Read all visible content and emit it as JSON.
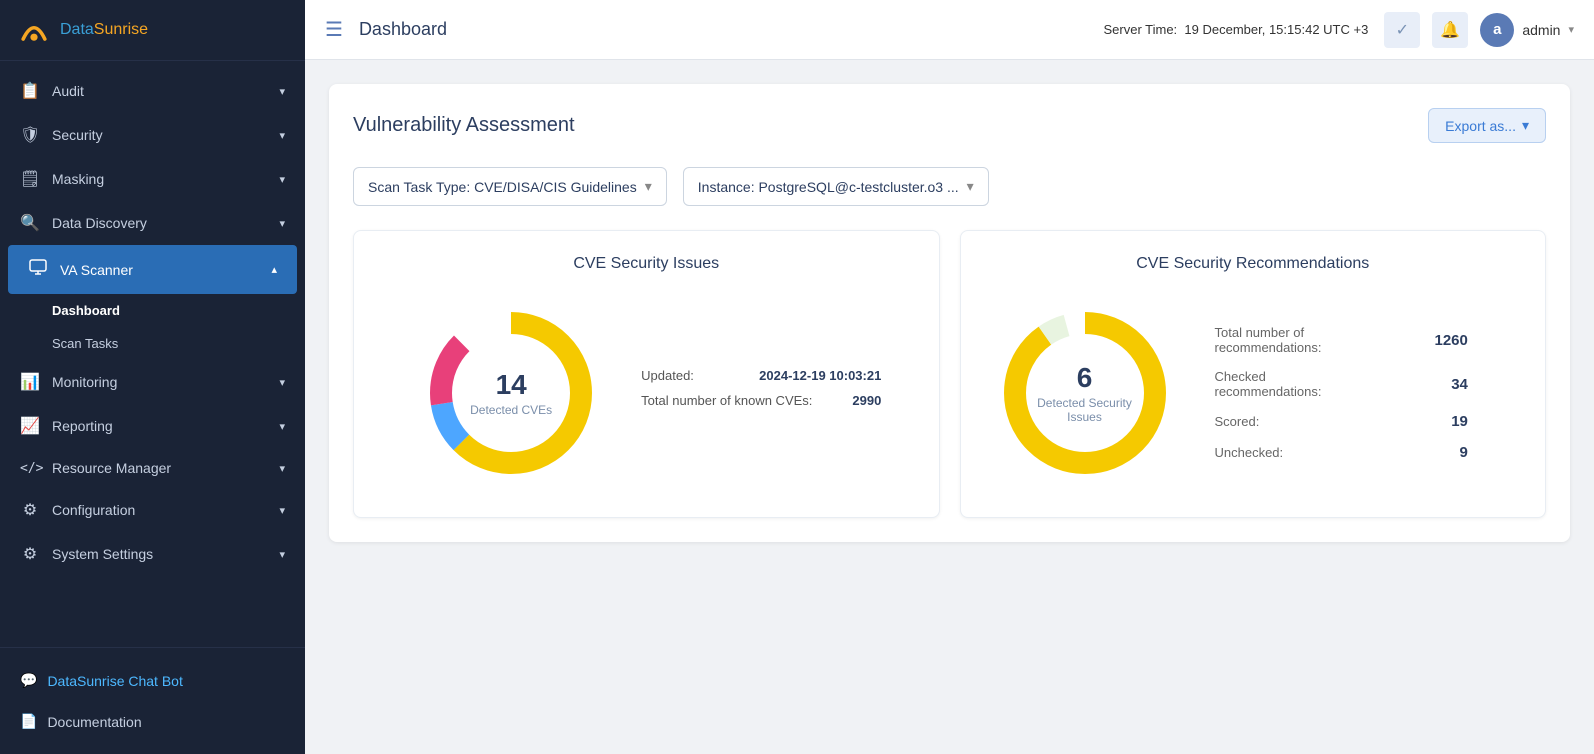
{
  "app": {
    "logo_data": "Data",
    "logo_sunrise": "Sunrise",
    "title": "Dashboard"
  },
  "header": {
    "title": "Dashboard",
    "server_time_label": "Server Time:",
    "server_time_value": "19 December, 15:15:42 UTC +3",
    "user_initial": "a",
    "user_name": "admin",
    "user_chevron": "▾"
  },
  "sidebar": {
    "items": [
      {
        "id": "audit",
        "label": "Audit",
        "icon": "📋",
        "has_children": true
      },
      {
        "id": "security",
        "label": "Security",
        "icon": "🛡",
        "has_children": true
      },
      {
        "id": "masking",
        "label": "Masking",
        "icon": "🗒",
        "has_children": true
      },
      {
        "id": "data-discovery",
        "label": "Data Discovery",
        "icon": "🔍",
        "has_children": true
      },
      {
        "id": "va-scanner",
        "label": "VA Scanner",
        "icon": "🖥",
        "has_children": true,
        "active": true
      },
      {
        "id": "monitoring",
        "label": "Monitoring",
        "icon": "📊",
        "has_children": true
      },
      {
        "id": "reporting",
        "label": "Reporting",
        "icon": "📈",
        "has_children": true
      },
      {
        "id": "resource-manager",
        "label": "Resource Manager",
        "icon": "⟨/⟩",
        "has_children": true
      },
      {
        "id": "configuration",
        "label": "Configuration",
        "icon": "⚙",
        "has_children": true
      },
      {
        "id": "system-settings",
        "label": "System Settings",
        "icon": "⚙",
        "has_children": true
      }
    ],
    "sub_items": [
      {
        "id": "dashboard",
        "label": "Dashboard",
        "active": true
      },
      {
        "id": "scan-tasks",
        "label": "Scan Tasks",
        "active": false
      }
    ],
    "chat_bot_label": "DataSunrise Chat Bot",
    "documentation_label": "Documentation"
  },
  "main": {
    "section_title": "Vulnerability Assessment",
    "export_btn_label": "Export as...",
    "scan_task_type_label": "Scan Task Type: CVE/DISA/CIS Guidelines",
    "instance_label": "Instance: PostgreSQL@c-testcluster.o3 ...",
    "cve_chart": {
      "title": "CVE Security Issues",
      "center_number": "14",
      "center_sub": "Detected CVEs",
      "updated_label": "Updated:",
      "updated_value": "2024-12-19 10:03:21",
      "known_cves_label": "Total number of known CVEs:",
      "known_cves_value": "2990",
      "segments": [
        {
          "color": "#f5c900",
          "pct": 75
        },
        {
          "color": "#4da6ff",
          "pct": 10
        },
        {
          "color": "#e84393",
          "pct": 15
        }
      ]
    },
    "rec_chart": {
      "title": "CVE Security Recommendations",
      "center_number": "6",
      "center_sub": "Detected Security Issues",
      "stats": [
        {
          "label": "Total number of recommendations:",
          "value": "1260"
        },
        {
          "label": "Checked recommendations:",
          "value": "34"
        },
        {
          "label": "Scored:",
          "value": "19"
        },
        {
          "label": "Unchecked:",
          "value": "9"
        }
      ]
    }
  }
}
